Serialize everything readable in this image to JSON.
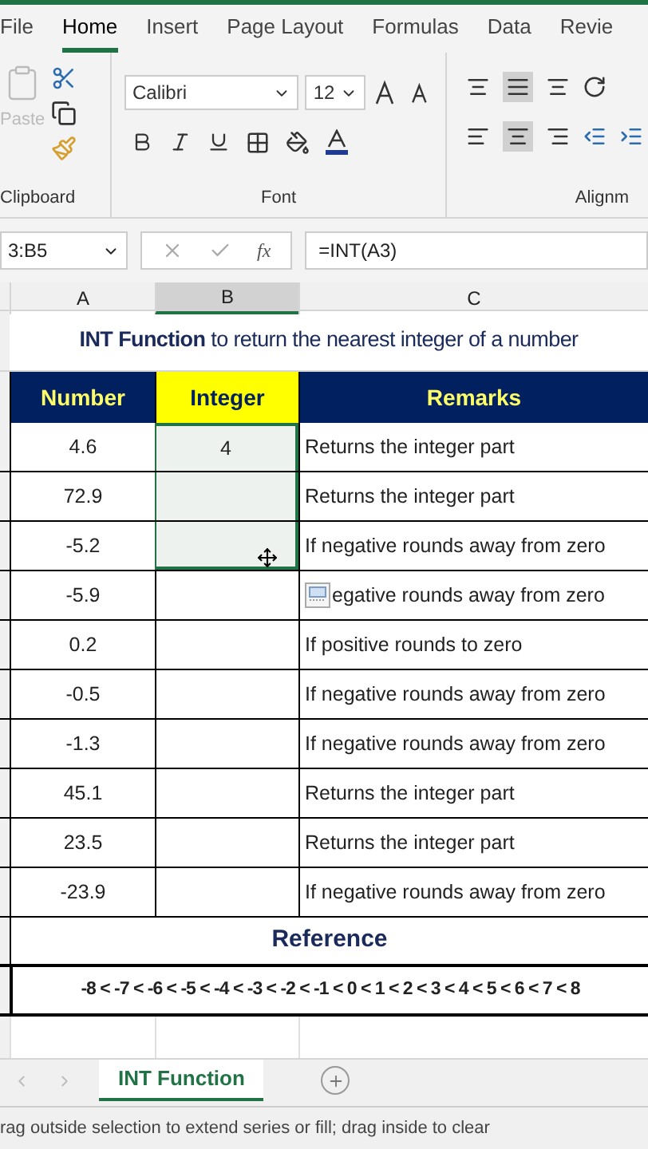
{
  "ribbon_tabs": [
    {
      "label": "File",
      "selected": false
    },
    {
      "label": "Home",
      "selected": true
    },
    {
      "label": "Insert",
      "selected": false
    },
    {
      "label": "Page Layout",
      "selected": false
    },
    {
      "label": "Formulas",
      "selected": false
    },
    {
      "label": "Data",
      "selected": false
    },
    {
      "label": "Revie",
      "selected": false
    }
  ],
  "ribbon": {
    "paste_label": "Paste",
    "font_name": "Calibri",
    "font_size": "12",
    "groups": [
      "Clipboard",
      "Font",
      "Alignm"
    ]
  },
  "formula_bar": {
    "name_box": "3:B5",
    "fx_label": "fx",
    "formula": "=INT(A3)"
  },
  "columns": [
    {
      "label": "A",
      "selected": false
    },
    {
      "label": "B",
      "selected": true
    },
    {
      "label": "C",
      "selected": false
    }
  ],
  "title": "**INT Function** to return the nearest integer of a number",
  "headers": [
    "Number",
    "Integer",
    "Remarks"
  ],
  "rows": [
    {
      "number": "4.6",
      "integer": "4",
      "remark": "Returns the integer part",
      "selected": true
    },
    {
      "number": "72.9",
      "remark": "Returns the integer part",
      "selected": true
    },
    {
      "number": "-5.2",
      "remark": "If negative rounds away from zero",
      "selected": true
    },
    {
      "number": "-5.9",
      "remark": "egative rounds away from zero",
      "selected": false,
      "kind": "covered"
    },
    {
      "number": "0.2",
      "remark": "If positive rounds to zero",
      "selected": false
    },
    {
      "number": "-0.5",
      "remark": "If negative rounds away from zero",
      "selected": false
    },
    {
      "number": "-1.3",
      "remark": "If negative rounds away from zero",
      "selected": false
    },
    {
      "number": "45.1",
      "remark": "Returns the integer part",
      "selected": false
    },
    {
      "number": "23.5",
      "remark": "Returns the integer part",
      "selected": false
    },
    {
      "number": "-23.9",
      "remark": "If negative rounds away from zero",
      "selected": false
    }
  ],
  "reference": {
    "title": "Reference",
    "values": "-8 < -7 < -6 < -5 < -4 < -3 < -2 < -1 < 0 < 1 < 2 < 3 < 4 < 5 < 6 < 7 < 8"
  },
  "sheet_tabs": [
    {
      "label": "INT Function",
      "selected": true
    }
  ],
  "status_bar": "rag outside selection to extend series or fill; drag inside to clear"
}
